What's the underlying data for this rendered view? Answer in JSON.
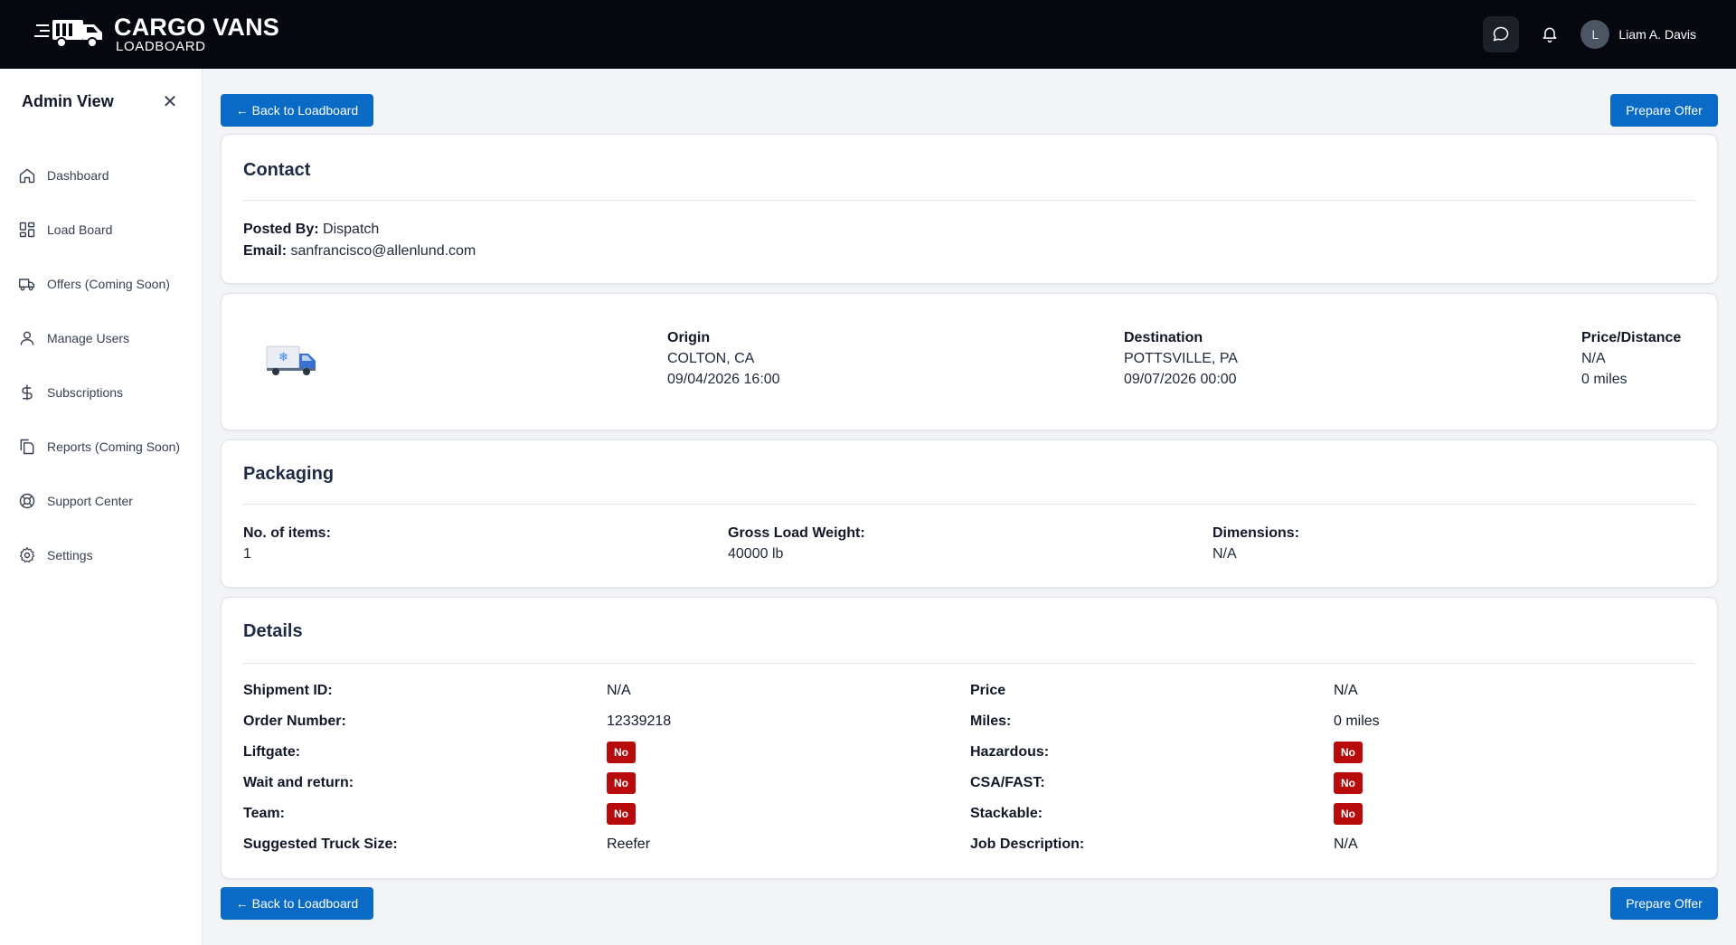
{
  "header": {
    "brand_title": "CARGO VANS",
    "brand_sub": "LOADBOARD",
    "user_initial": "L",
    "user_name": "Liam A. Davis"
  },
  "sidebar": {
    "title": "Admin View",
    "close_symbol": "✕",
    "items": [
      {
        "label": "Dashboard",
        "icon": "home-icon"
      },
      {
        "label": "Load Board",
        "icon": "grid-icon"
      },
      {
        "label": "Offers (Coming Soon)",
        "icon": "truck-icon"
      },
      {
        "label": "Manage Users",
        "icon": "user-icon"
      },
      {
        "label": "Subscriptions",
        "icon": "dollar-icon"
      },
      {
        "label": "Reports (Coming Soon)",
        "icon": "files-icon"
      },
      {
        "label": "Support Center",
        "icon": "lifebuoy-icon"
      },
      {
        "label": "Settings",
        "icon": "gear-icon"
      }
    ]
  },
  "actions": {
    "back_label": "← Back to Loadboard",
    "offer_label": "Prepare Offer"
  },
  "contact": {
    "title": "Contact",
    "posted_by_label": "Posted By:",
    "posted_by": "Dispatch",
    "email_label": "Email:",
    "email": "sanfrancisco@allenlund.com"
  },
  "route": {
    "origin_label": "Origin",
    "origin_city": "COLTON, CA",
    "origin_date": "09/04/2026 16:00",
    "destination_label": "Destination",
    "destination_city": "POTTSVILLE, PA",
    "destination_date": "09/07/2026 00:00",
    "price_label": "Price/Distance",
    "price": "N/A",
    "distance": "0 miles"
  },
  "packaging": {
    "title": "Packaging",
    "items_label": "No. of items:",
    "items": "1",
    "weight_label": "Gross Load Weight:",
    "weight": "40000 lb",
    "dims_label": "Dimensions:",
    "dims": "N/A"
  },
  "details": {
    "title": "Details",
    "left": [
      {
        "label": "Shipment ID:",
        "value": "N/A",
        "badge": false
      },
      {
        "label": "Order Number:",
        "value": "12339218",
        "badge": false
      },
      {
        "label": "Liftgate:",
        "value": "No",
        "badge": true
      },
      {
        "label": "Wait and return:",
        "value": "No",
        "badge": true
      },
      {
        "label": "Team:",
        "value": "No",
        "badge": true
      },
      {
        "label": "Suggested Truck Size:",
        "value": "Reefer",
        "badge": false
      }
    ],
    "right": [
      {
        "label": "Price",
        "value": "N/A",
        "badge": false
      },
      {
        "label": "Miles:",
        "value": "0 miles",
        "badge": false
      },
      {
        "label": "Hazardous:",
        "value": "No",
        "badge": true
      },
      {
        "label": "CSA/FAST:",
        "value": "No",
        "badge": true
      },
      {
        "label": "Stackable:",
        "value": "No",
        "badge": true
      },
      {
        "label": "Job Description:",
        "value": "N/A",
        "badge": false
      }
    ]
  },
  "colors": {
    "topbar": "#05090f",
    "primary_button": "#0a6bc6",
    "badge_no": "#b80c0c"
  }
}
